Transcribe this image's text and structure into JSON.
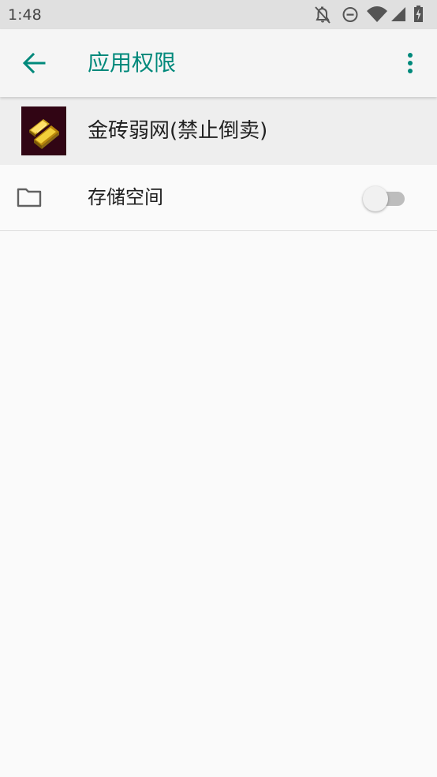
{
  "status_bar": {
    "time": "1:48",
    "icons": [
      "notifications-off-icon",
      "do-not-disturb-icon",
      "wifi-icon",
      "cellular-signal-icon",
      "battery-charging-icon"
    ]
  },
  "app_bar": {
    "title": "应用权限",
    "back_icon": "arrow-back-icon",
    "menu_icon": "more-vert-icon",
    "accent_color": "#00897b"
  },
  "app_header": {
    "app_name": "金砖弱网(禁止倒卖)",
    "icon": "gold-bar-app-icon"
  },
  "permissions": [
    {
      "label": "存储空间",
      "icon": "folder-icon",
      "enabled": false
    }
  ]
}
